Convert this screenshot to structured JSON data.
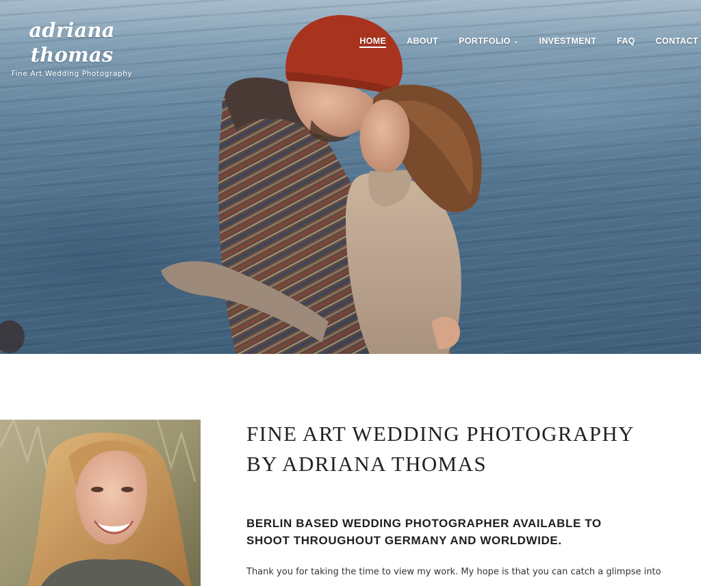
{
  "header": {
    "logo_name": "adriana thomas",
    "logo_tagline": "Fine Art Wedding Photography",
    "nav": [
      {
        "label": "HOME",
        "active": true
      },
      {
        "label": "ABOUT",
        "active": false
      },
      {
        "label": "PORTFOLIO",
        "active": false,
        "has_dropdown": true
      },
      {
        "label": "INVESTMENT",
        "active": false
      },
      {
        "label": "FAQ",
        "active": false
      },
      {
        "label": "CONTACT",
        "active": false
      }
    ]
  },
  "hero": {
    "image": "couple-embracing-by-the-sea-photo"
  },
  "about": {
    "portrait_image": "smiling-woman-portrait-photo",
    "heading_line1": "FINE ART WEDDING PHOTOGRAPHY",
    "heading_line2": "BY ADRIANA THOMAS",
    "subheading_line1": "BERLIN BASED WEDDING PHOTOGRAPHER AVAILABLE TO",
    "subheading_line2": "SHOOT THROUGHOUT GERMANY AND WORLDWIDE.",
    "body": "Thank you for taking the time to view my work. My hope is that you can catch a glimpse into"
  },
  "colors": {
    "nav_text": "#ffffff",
    "heading_text": "#222222",
    "body_text": "#333333",
    "background": "#ffffff"
  }
}
